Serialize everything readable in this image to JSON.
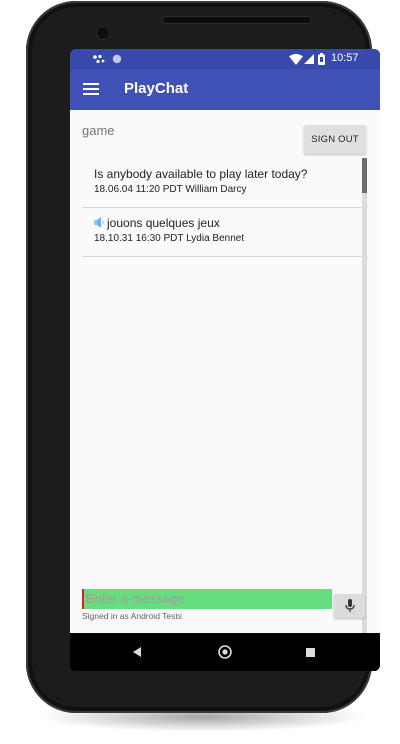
{
  "status_bar": {
    "time": "10:57",
    "left_icons": [
      "assistant-dots-icon",
      "sync-icon"
    ],
    "right_icons": [
      "wifi-icon",
      "signal-icon",
      "battery-icon"
    ]
  },
  "toolbar": {
    "title": "PlayChat",
    "menu_icon": "hamburger-menu-icon"
  },
  "content": {
    "room_name": "game",
    "sign_out_label": "SIGN OUT",
    "messages": [
      {
        "text": "Is anybody available to play later today?",
        "meta": "18.06.04 11:20 PDT William Darcy",
        "icon": ""
      },
      {
        "text": "jouons quelques jeux",
        "meta": "18.10.31 16:30 PDT Lydia Bennet",
        "icon": "speaker-icon"
      }
    ],
    "input_placeholder": "Enter a message",
    "signed_in_text": "Signed in as Android Tests",
    "mic_icon": "microphone-icon"
  },
  "nav_bar": {
    "buttons": [
      "back-icon",
      "home-icon",
      "recents-icon"
    ]
  },
  "colors": {
    "toolbar": "#3f51b5",
    "status_bar": "#3949ab",
    "input_highlight": "#66dd7e",
    "cursor": "#c62828"
  }
}
